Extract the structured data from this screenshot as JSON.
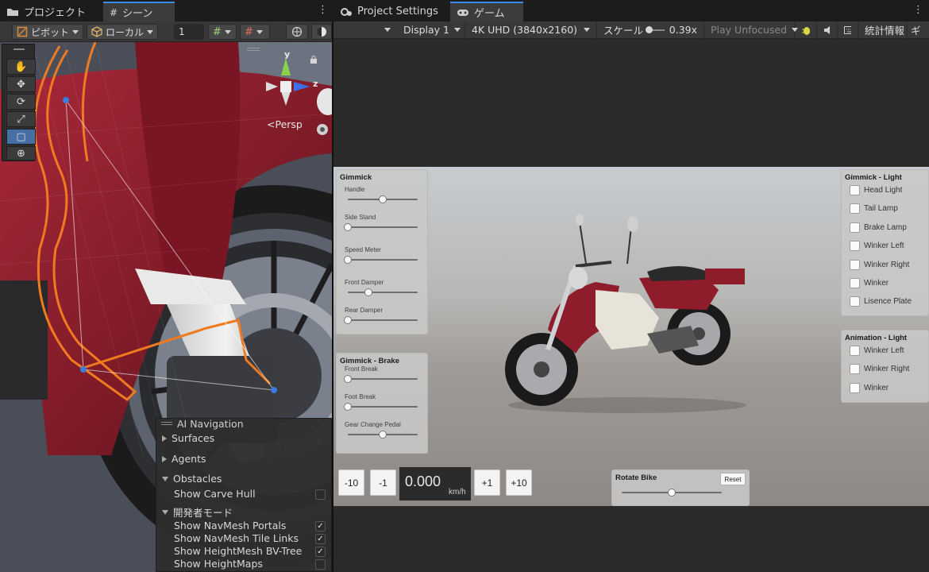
{
  "tabs": {
    "project": "プロジェクト",
    "scene": "シーン",
    "project_settings": "Project Settings",
    "game": "ゲーム"
  },
  "scene_toolbar": {
    "pivot": "ピボット",
    "local": "ローカル",
    "snap_value": "1"
  },
  "game_toolbar": {
    "display": "Display 1",
    "resolution": "4K UHD (3840x2160)",
    "scale_label": "スケール",
    "scale_value": "0.39x",
    "play_mode": "Play Unfocused",
    "stats": "統計情報",
    "gizmos": "ギ"
  },
  "scene_view": {
    "persp_label": "<Persp",
    "axis_y": "y",
    "axis_z": "z"
  },
  "ai_navigation": {
    "title": "AI Navigation",
    "surfaces": "Surfaces",
    "agents": "Agents",
    "obstacles": "Obstacles",
    "show_carve_hull": "Show Carve Hull",
    "developer_mode": "開発者モード",
    "show_navmesh_portals": "Show NavMesh Portals",
    "show_navmesh_tile_links": "Show NavMesh Tile Links",
    "show_heightmesh_bvtree": "Show HeightMesh BV-Tree",
    "show_heightmaps": "Show HeightMaps",
    "checked": {
      "show_carve_hull": false,
      "show_navmesh_portals": true,
      "show_navmesh_tile_links": true,
      "show_heightmesh_bvtree": true,
      "show_heightmaps": false
    }
  },
  "gimmick": {
    "title": "Gimmick",
    "sliders": [
      {
        "label": "Handle",
        "value": 0.5
      },
      {
        "label": "Side Stand",
        "value": 0.0
      },
      {
        "label": "Speed Meter",
        "value": 0.0
      },
      {
        "label": "Front Damper",
        "value": 0.3
      },
      {
        "label": "Rear Damper",
        "value": 0.0
      }
    ]
  },
  "gimmick_brake": {
    "title": "Gimmick - Brake",
    "sliders": [
      {
        "label": "Front Break",
        "value": 0.0
      },
      {
        "label": "Foot Break",
        "value": 0.0
      },
      {
        "label": "Gear Change Pedal",
        "value": 0.5
      }
    ]
  },
  "gimmick_light": {
    "title": "Gimmick - Light",
    "items": [
      "Head Light",
      "Tail Lamp",
      "Brake Lamp",
      "Winker Left",
      "Winker Right",
      "Winker",
      "Lisence Plate"
    ]
  },
  "animation_light": {
    "title": "Animation - Light",
    "items": [
      "Winker Left",
      "Winker Right",
      "Winker"
    ]
  },
  "speed": {
    "minus10": "-10",
    "minus1": "-1",
    "value": "0.000",
    "unit": "km/h",
    "plus1": "+1",
    "plus10": "+10"
  },
  "rotate_bike": {
    "title": "Rotate Bike",
    "reset": "Reset",
    "value": 0.5
  },
  "colors": {
    "accent": "#3a8ee6",
    "bike_red": "#8e1c2a",
    "selection_orange": "#f07a20"
  }
}
